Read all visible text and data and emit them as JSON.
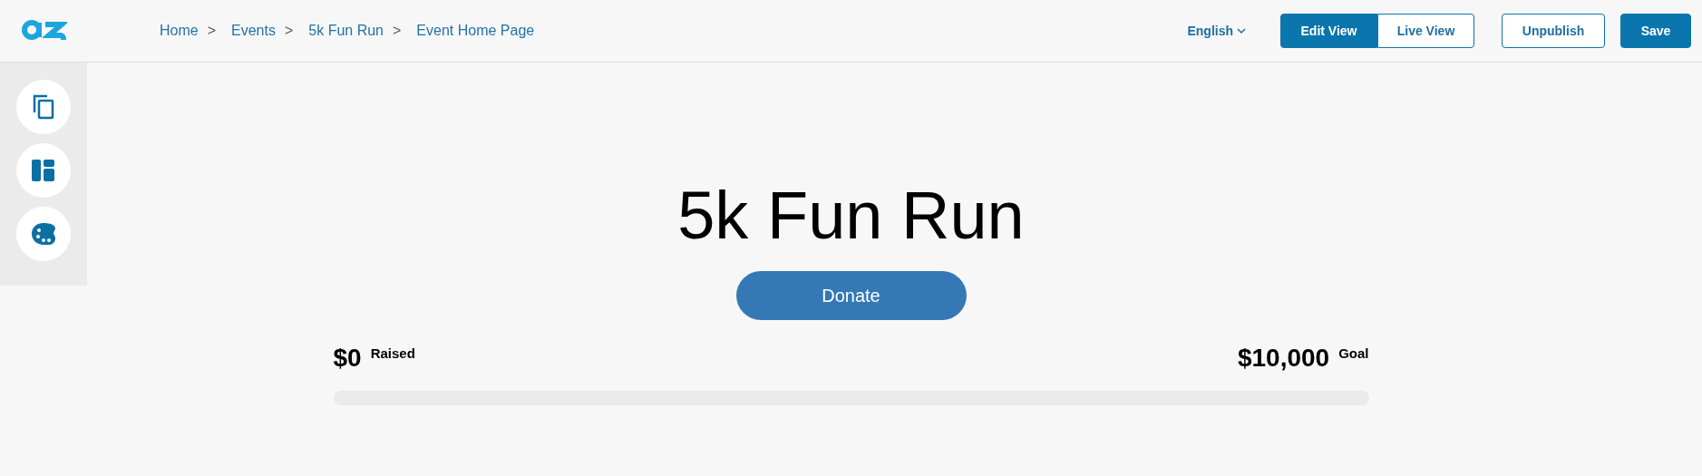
{
  "breadcrumbs": [
    {
      "label": "Home",
      "separator": ">"
    },
    {
      "label": "Events",
      "separator": ">"
    },
    {
      "label": "5k Fun Run",
      "separator": ">"
    },
    {
      "label": "Event Home Page"
    }
  ],
  "language": "English",
  "view_toggle": [
    {
      "label": "Edit View",
      "selected": true
    },
    {
      "label": "Live View",
      "selected": false
    }
  ],
  "actions": [
    {
      "label": "Unpublish",
      "kind": "outline"
    },
    {
      "label": "Save",
      "kind": "primary"
    }
  ],
  "sidebar": {
    "items": [
      {
        "kind": "pages"
      },
      {
        "kind": "layout"
      },
      {
        "kind": "theme"
      }
    ]
  },
  "event": {
    "title": "5k Fun Run",
    "donate_button": "Donate",
    "raised_amount": "$0",
    "raised_label": "Raised",
    "goal_amount": "$10,000",
    "goal_label": "Goal",
    "progress": {
      "level": 0
    }
  }
}
